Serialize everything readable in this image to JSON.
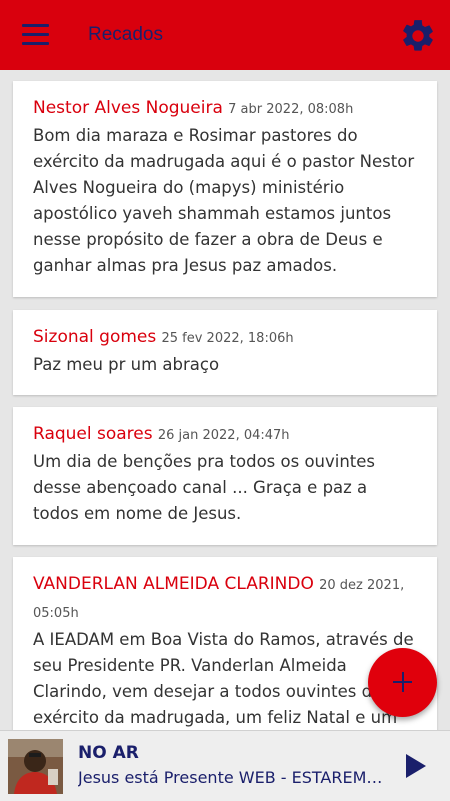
{
  "app": {
    "title": "Recados",
    "colors": {
      "primary": "#d9000d",
      "accent": "#1a1f6b",
      "background": "#e6e6e6"
    },
    "icons": {
      "menu": "hamburger-menu-icon",
      "settings": "gear-icon",
      "add": "plus-icon",
      "play": "play-icon"
    }
  },
  "messages": [
    {
      "author": "Nestor Alves Nogueira",
      "date": "7 abr 2022, 08:08h",
      "text": "Bom dia maraza e Rosimar pastores do exército da madrugada aqui é o pastor Nestor Alves Nogueira do (mapys) ministério apostólico yaveh shammah estamos juntos nesse propósito de fazer a obra de Deus e ganhar almas pra Jesus paz amados."
    },
    {
      "author": "Sizonal gomes",
      "date": "25 fev 2022, 18:06h",
      "text": "Paz meu pr um abraço"
    },
    {
      "author": "Raquel soares",
      "date": "26 jan 2022, 04:47h",
      "text": "Um dia de benções pra todos os ouvintes desse abençoado canal ... Graça e paz a todos em nome de Jesus."
    },
    {
      "author": "VANDERLAN ALMEIDA CLARINDO",
      "date": "20 dez 2021, 05:05h",
      "text": "A IEADAM em Boa Vista do Ramos,  através de seu Presidente PR. Vanderlan Almeida Clarindo,  vem desejar a todos ouvintes do exército da madrugada, um feliz Natal e um"
    }
  ],
  "player": {
    "status": "NO AR",
    "program": "Jesus está Presente WEB - ESTAREMOS"
  }
}
